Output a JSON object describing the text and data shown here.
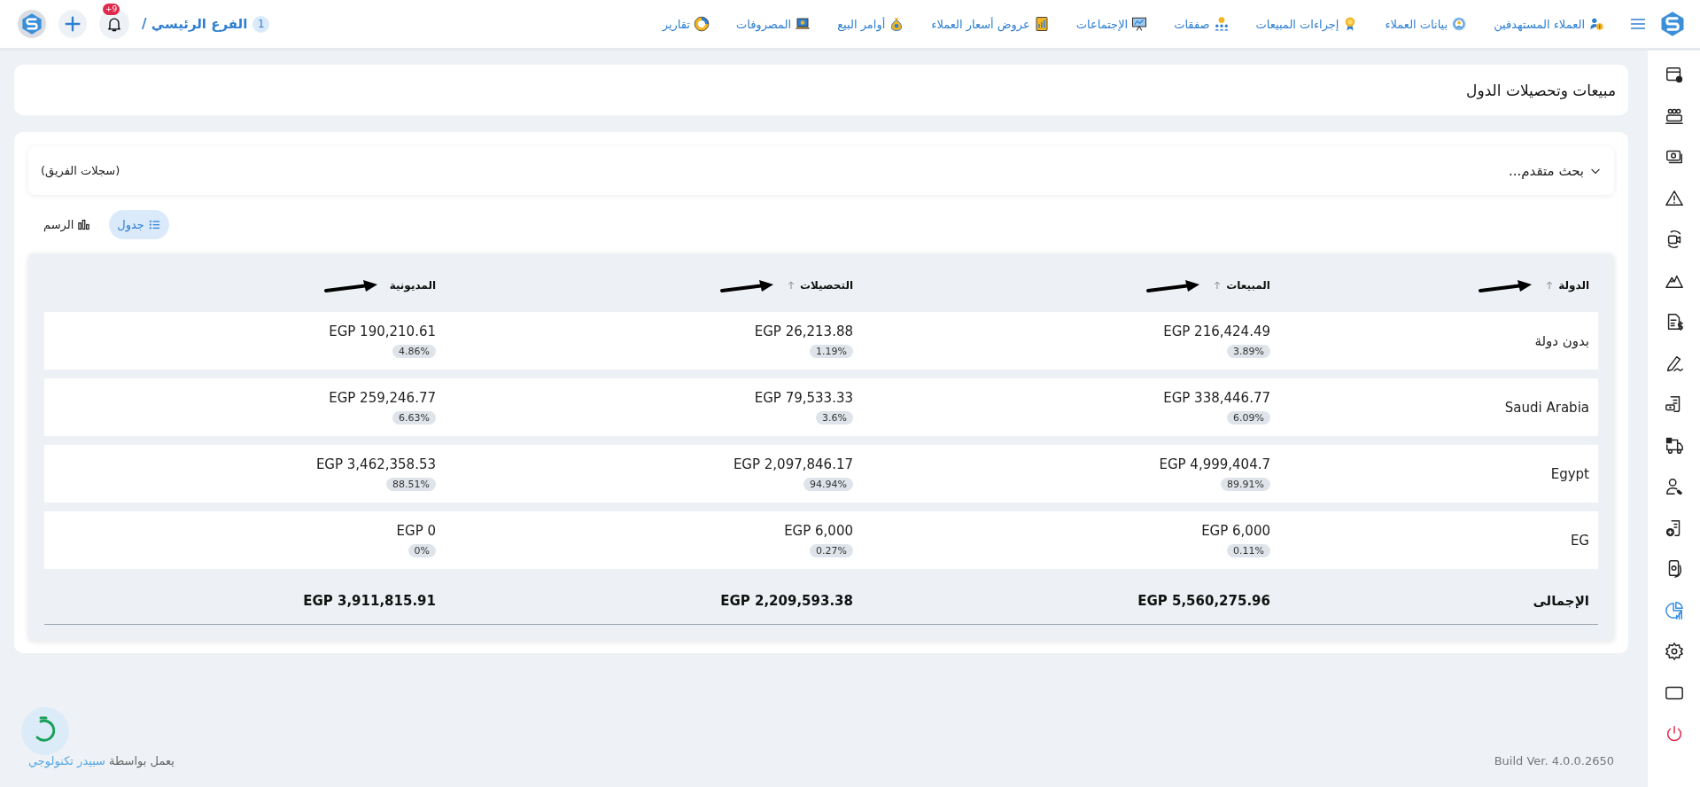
{
  "topbar": {
    "nav": [
      {
        "label": "العملاء المستهدفين"
      },
      {
        "label": "بيانات العملاء"
      },
      {
        "label": "إجراءات المبيعات"
      },
      {
        "label": "صفقات"
      },
      {
        "label": "الإجتماعات"
      },
      {
        "label": "عروض أسعار العملاء"
      },
      {
        "label": "أوامر البيع"
      },
      {
        "label": "المصروفات"
      },
      {
        "label": "تقارير"
      }
    ],
    "branch_number": "1",
    "branch": "الفرع الرئيسي /",
    "notifications_badge": "+9"
  },
  "page_title": "مبيعات وتحصيلات الدول",
  "filter": {
    "toggle": "بحث متقدم...",
    "expanded": false,
    "scope": "(سجلات الفريق)"
  },
  "views": [
    {
      "label": "جدول",
      "selected": true
    },
    {
      "label": "الرسم",
      "selected": false
    }
  ],
  "table": {
    "columns": [
      {
        "label": "الدولة",
        "sortable": true,
        "annotated": true
      },
      {
        "label": "المبيعات",
        "sortable": true,
        "annotated": true
      },
      {
        "label": "التحصيلات",
        "sortable": true,
        "annotated": true
      },
      {
        "label": "المديونية",
        "sortable": false,
        "annotated": true
      }
    ],
    "rows": [
      {
        "cells": [
          {
            "value": "بدون دولة"
          },
          {
            "value": "EGP 216,424.49",
            "share": "3.89%"
          },
          {
            "value": "EGP 26,213.88",
            "share": "1.19%"
          },
          {
            "value": "EGP 190,210.61",
            "share": "4.86%"
          }
        ]
      },
      {
        "cells": [
          {
            "value": "Saudi Arabia"
          },
          {
            "value": "EGP 338,446.77",
            "share": "6.09%"
          },
          {
            "value": "EGP 79,533.33",
            "share": "3.6%"
          },
          {
            "value": "EGP 259,246.77",
            "share": "6.63%"
          }
        ]
      },
      {
        "cells": [
          {
            "value": "Egypt"
          },
          {
            "value": "EGP 4,999,404.7",
            "share": "89.91%"
          },
          {
            "value": "EGP 2,097,846.17",
            "share": "94.94%"
          },
          {
            "value": "EGP 3,462,358.53",
            "share": "88.51%"
          }
        ]
      },
      {
        "cells": [
          {
            "value": "EG"
          },
          {
            "value": "EGP 6,000",
            "share": "0.11%"
          },
          {
            "value": "EGP 6,000",
            "share": "0.27%"
          },
          {
            "value": "EGP 0",
            "share": "0%"
          }
        ]
      }
    ],
    "total": {
      "label": "الإجمالى",
      "values": [
        "EGP 5,560,275.96",
        "EGP 2,209,593.38",
        "EGP 3,911,815.91"
      ]
    }
  },
  "sidebar": {
    "items": [
      {
        "selected": false
      },
      {
        "selected": false
      },
      {
        "selected": false
      },
      {
        "selected": false
      },
      {
        "selected": false
      },
      {
        "selected": false
      },
      {
        "selected": false
      },
      {
        "selected": false
      },
      {
        "selected": false
      },
      {
        "selected": false
      },
      {
        "selected": false
      },
      {
        "selected": false
      },
      {
        "selected": false
      },
      {
        "selected": true
      },
      {
        "selected": false
      },
      {
        "selected": false
      },
      {
        "selected": false
      }
    ]
  },
  "footer": {
    "powered_by": "يعمل بواسطة",
    "company": "سبيدر تكنولوجي",
    "build": "Build Ver. 4.0.0.2650"
  }
}
